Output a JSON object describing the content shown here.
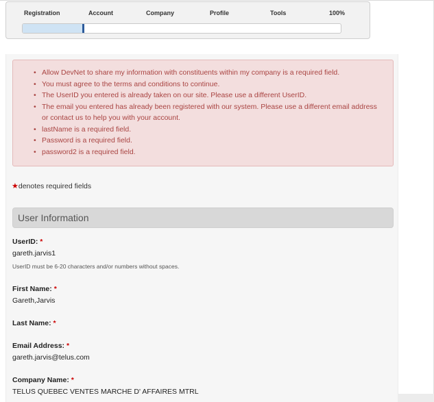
{
  "progress": {
    "steps": [
      "Registration",
      "Account",
      "Company",
      "Profile",
      "Tools"
    ],
    "percent_label": "100%",
    "fill_fraction": 0.19
  },
  "errors": [
    "Allow DevNet to share my information with constituents within my company is a required field.",
    "You must agree to the terms and conditions to continue.",
    "The UserID you entered is already taken on our site. Please use a different UserID.",
    "The email you entered has already been registered with our system. Please use a different email address or contact us to help you with your account.",
    "lastName is a required field.",
    "Password is a required field.",
    "password2 is a required field."
  ],
  "required_note": {
    "star": "★",
    "text": "denotes required fields"
  },
  "section": {
    "title": "User Information"
  },
  "fields": {
    "userid": {
      "label": "UserID:",
      "value": "gareth.jarvis1",
      "hint": "UserID must be 6-20 characters and/or numbers without spaces."
    },
    "first_name": {
      "label": "First Name:",
      "value": "Gareth,Jarvis"
    },
    "last_name": {
      "label": "Last Name:",
      "value": ""
    },
    "email": {
      "label": "Email Address:",
      "value": "gareth.jarvis@telus.com"
    },
    "company": {
      "label": "Company Name:",
      "value": "TELUS QUEBEC VENTES MARCHE D' AFFAIRES MTRL"
    }
  },
  "required_mark": "*",
  "colors": {
    "error_text": "#a94442",
    "error_bg": "#f3dede",
    "required": "#cc0000",
    "progress_fill": "#cfe3f4",
    "progress_marker": "#2d5b9b"
  }
}
